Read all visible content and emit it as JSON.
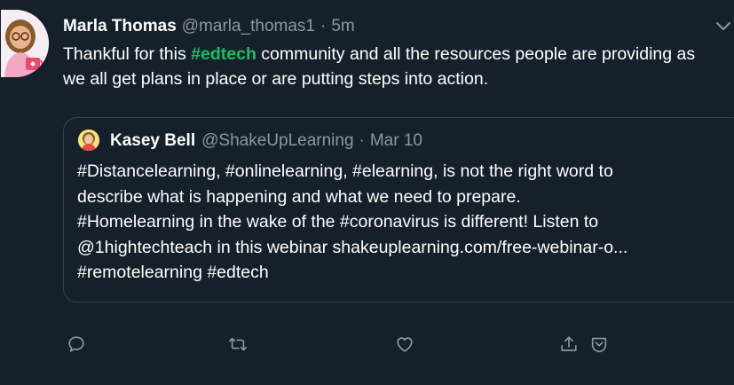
{
  "tweet": {
    "author_name": "Marla Thomas",
    "handle": "@marla_thomas1",
    "separator": "·",
    "time": "5m",
    "text_parts": [
      "Thankful for this ",
      "#edtech",
      " community and all the resources people are providing as we all get plans in place or are putting steps into action."
    ]
  },
  "quoted_tweet": {
    "author_name": "Kasey Bell",
    "handle": "@ShakeUpLearning",
    "separator": "·",
    "date": "Mar 10",
    "lines": [
      "#Distancelearning, #onlinelearning, #elearning, is not the right word to",
      "describe what is happening and what we need to prepare.",
      "#Homelearning in the wake of the #coronavirus is different! Listen to",
      "@1hightechteach in this webinar shakeuplearning.com/free-webinar-o...",
      "#remotelearning #edtech"
    ]
  },
  "actions": [
    "reply-icon",
    "retweet-icon",
    "like-icon",
    "share-icon",
    "tweet-menu-icon"
  ],
  "colors": {
    "background": "#15202b",
    "secondary_text": "#8899a6",
    "hashtag": "#17bf63",
    "border": "#38444d"
  }
}
